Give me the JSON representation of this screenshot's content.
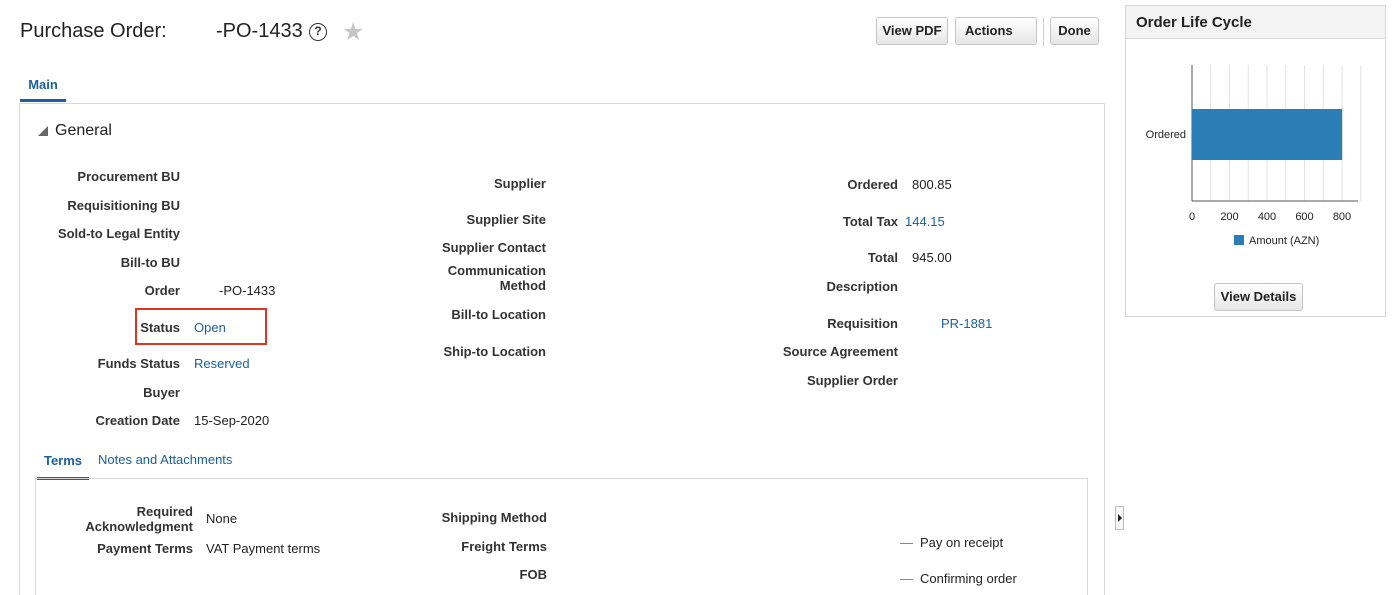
{
  "header": {
    "title": "Purchase Order:",
    "po_number": "-PO-1433",
    "help_glyph": "?",
    "star_glyph": "★",
    "view_pdf": "View PDF",
    "actions": "Actions",
    "done": "Done"
  },
  "tabs": {
    "main": "Main"
  },
  "general": {
    "title": "General",
    "col1": [
      {
        "label": "Procurement BU",
        "value": ""
      },
      {
        "label": "Requisitioning BU",
        "value": ""
      },
      {
        "label": "Sold-to Legal Entity",
        "value": ""
      },
      {
        "label": "Bill-to BU",
        "value": ""
      },
      {
        "label": "Order",
        "value": "-PO-1433"
      },
      {
        "label": "Status",
        "value": "Open"
      },
      {
        "label": "Funds Status",
        "value": "Reserved"
      },
      {
        "label": "Buyer",
        "value": ""
      },
      {
        "label": "Creation Date",
        "value": "15-Sep-2020"
      }
    ],
    "col2": [
      {
        "label": "Supplier"
      },
      {
        "label": "Supplier Site"
      },
      {
        "label": "Supplier Contact"
      },
      {
        "label": "Communication Method"
      },
      {
        "label": "Bill-to Location"
      },
      {
        "label": "Ship-to Location"
      }
    ],
    "col3": [
      {
        "label": "Ordered",
        "value": "800.85"
      },
      {
        "label": "Total Tax",
        "value": "144.15"
      },
      {
        "label": "Total",
        "value": "945.00"
      },
      {
        "label": "Description",
        "value": ""
      },
      {
        "label": "Requisition",
        "value": "PR-1881"
      },
      {
        "label": "Source Agreement",
        "value": ""
      },
      {
        "label": "Supplier Order",
        "value": ""
      }
    ]
  },
  "sub_tabs": {
    "terms": "Terms",
    "notes": "Notes and Attachments"
  },
  "terms": {
    "required_ack_label": "Required Acknowledgment",
    "required_ack_value": "None",
    "payment_terms_label": "Payment Terms",
    "payment_terms_value": "VAT Payment terms",
    "shipping_method_label": "Shipping Method",
    "freight_terms_label": "Freight Terms",
    "fob_label": "FOB",
    "pay_on_receipt": "Pay on receipt",
    "confirming_order": "Confirming order"
  },
  "life_cycle": {
    "title": "Order Life Cycle",
    "view_details": "View Details"
  },
  "colors": {
    "link": "#1a5f9e",
    "highlight": "#e1341e",
    "bar": "#2a7db5"
  },
  "chart_data": {
    "type": "bar",
    "orientation": "horizontal",
    "categories": [
      "Ordered"
    ],
    "series": [
      {
        "name": "Amount (AZN)",
        "values": [
          800.85
        ]
      }
    ],
    "xlim": [
      0,
      950
    ],
    "xticks": [
      0,
      200,
      400,
      600,
      800
    ],
    "grid": true,
    "legend": "bottom"
  }
}
